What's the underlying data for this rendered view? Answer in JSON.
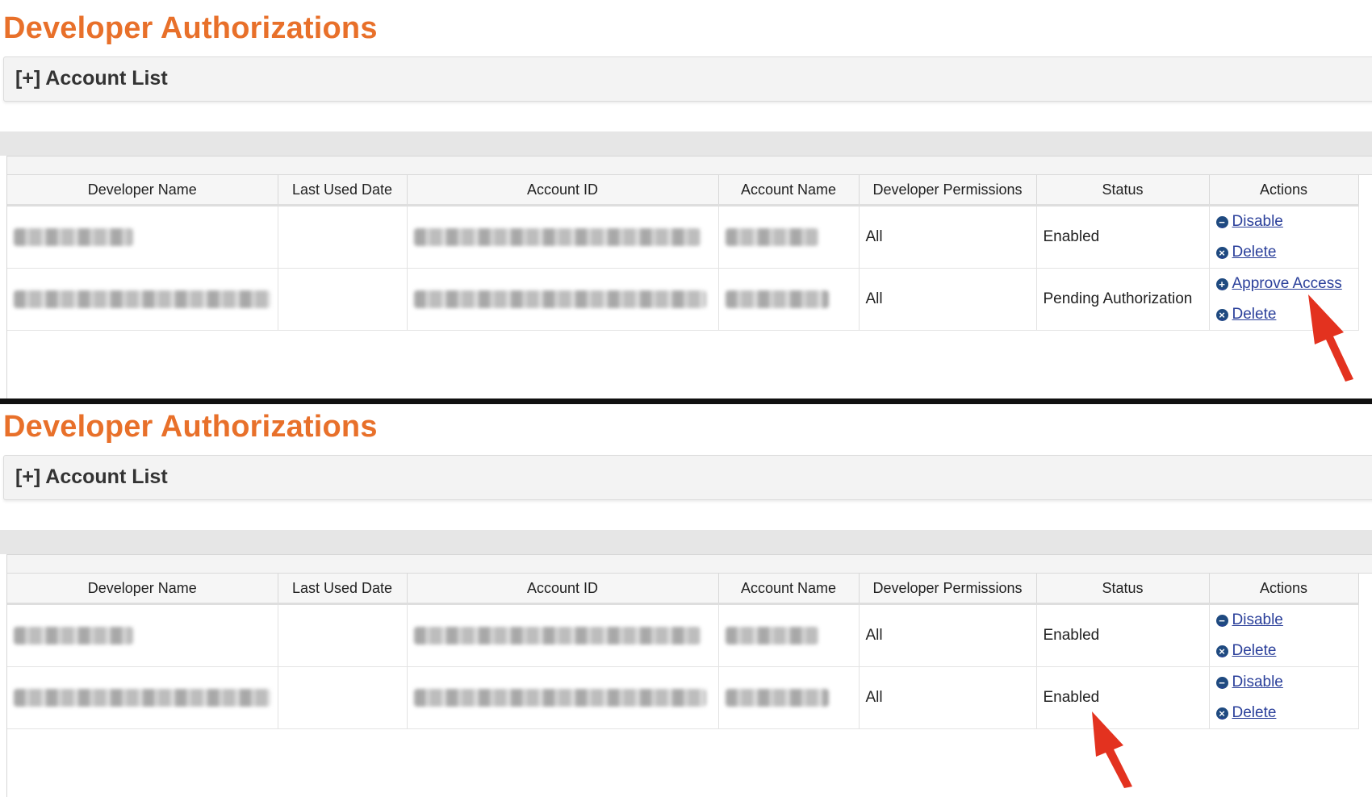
{
  "colors": {
    "title": "#e8702a",
    "link": "#2a3f9a",
    "icon": "#1f4a80",
    "arrow": "#e3321f"
  },
  "panels": [
    {
      "title": "Developer Authorizations",
      "account_list_label": "[+] Account List",
      "columns": [
        "Developer Name",
        "Last Used Date",
        "Account ID",
        "Account Name",
        "Developer Permissions",
        "Status",
        "Actions"
      ],
      "rows": [
        {
          "last_used": "",
          "permissions": "All",
          "status": "Enabled",
          "actions": [
            {
              "label": "Disable",
              "icon": "minus-circle-icon"
            },
            {
              "label": "Delete",
              "icon": "x-circle-icon"
            }
          ]
        },
        {
          "last_used": "",
          "permissions": "All",
          "status": "Pending Authorization",
          "actions": [
            {
              "label": "Approve Access",
              "icon": "plus-circle-icon"
            },
            {
              "label": "Delete",
              "icon": "x-circle-icon"
            }
          ]
        }
      ]
    },
    {
      "title": "Developer Authorizations",
      "account_list_label": "[+] Account List",
      "columns": [
        "Developer Name",
        "Last Used Date",
        "Account ID",
        "Account Name",
        "Developer Permissions",
        "Status",
        "Actions"
      ],
      "rows": [
        {
          "last_used": "",
          "permissions": "All",
          "status": "Enabled",
          "actions": [
            {
              "label": "Disable",
              "icon": "minus-circle-icon"
            },
            {
              "label": "Delete",
              "icon": "x-circle-icon"
            }
          ]
        },
        {
          "last_used": "",
          "permissions": "All",
          "status": "Enabled",
          "actions": [
            {
              "label": "Disable",
              "icon": "minus-circle-icon"
            },
            {
              "label": "Delete",
              "icon": "x-circle-icon"
            }
          ]
        }
      ]
    }
  ]
}
